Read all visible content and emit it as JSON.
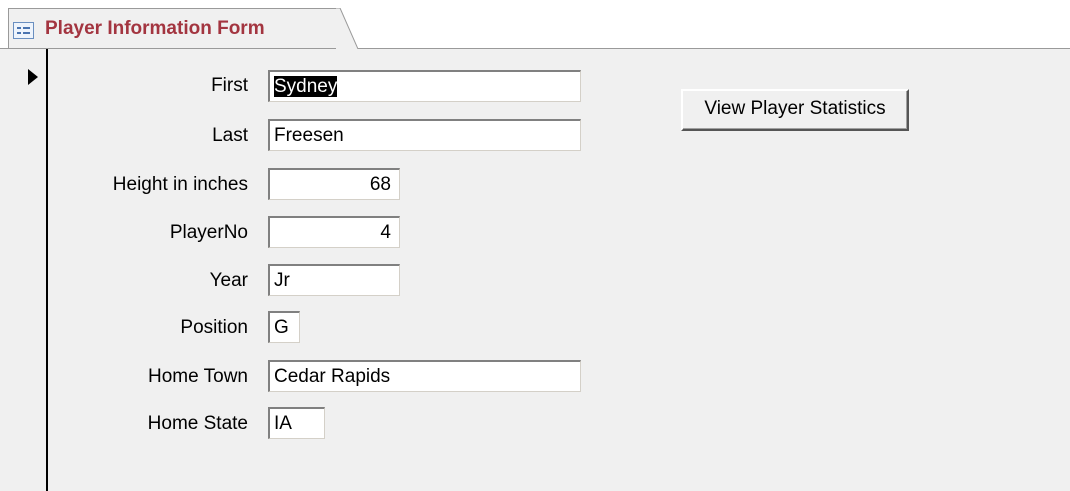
{
  "tab": {
    "title": "Player Information Form",
    "icon": "form-icon"
  },
  "fields": {
    "first": {
      "label": "First",
      "value": "Sydney"
    },
    "last": {
      "label": "Last",
      "value": "Freesen"
    },
    "height": {
      "label": "Height in inches",
      "value": "68"
    },
    "player_no": {
      "label": "PlayerNo",
      "value": "4"
    },
    "year": {
      "label": "Year",
      "value": "Jr"
    },
    "position": {
      "label": "Position",
      "value": "G"
    },
    "home_town": {
      "label": "Home Town",
      "value": "Cedar Rapids"
    },
    "home_state": {
      "label": "Home State",
      "value": "IA"
    }
  },
  "buttons": {
    "view_stats": "View Player Statistics"
  },
  "colors": {
    "tab_title": "#a33540",
    "form_bg": "#f0f0f0"
  }
}
